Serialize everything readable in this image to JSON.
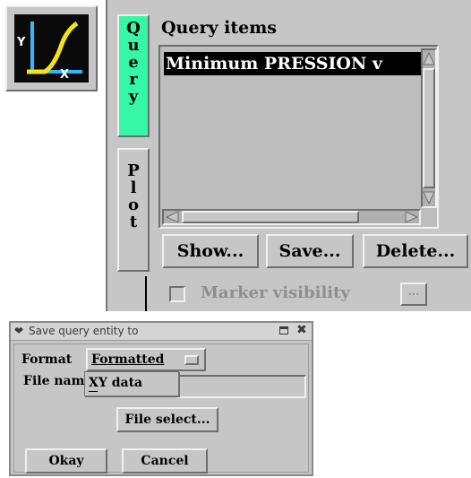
{
  "toolbar_icon": {
    "name": "xy-plot-icon",
    "y_label": "Y",
    "x_label": "X"
  },
  "tabs": {
    "query": {
      "letters": [
        "Q",
        "u",
        "e",
        "r",
        "y"
      ]
    },
    "plot": {
      "letters": [
        "P",
        "l",
        "o",
        "t"
      ]
    }
  },
  "query_panel": {
    "title": "Query items",
    "items": [
      "Minimum PRESSION v"
    ],
    "show_label": "Show...",
    "save_label": "Save...",
    "delete_label": "Delete...",
    "marker_label": "Marker visibility",
    "marker_more_label": "..."
  },
  "dialog": {
    "title": "Save query entity to",
    "format_label": "Format",
    "format_value": "Formatted",
    "filename_label": "File name",
    "dropdown_options": [
      "XY data"
    ],
    "file_select_label": "File select...",
    "okay_label": "Okay",
    "cancel_label": "Cancel"
  },
  "colors": {
    "panel": "#c6c6c6",
    "active_tab": "#35f7a5",
    "list_bg": "#bdbdbd",
    "selection": "#000000",
    "icon_bg": "#0a0a0a",
    "icon_curve": "#f6e312",
    "icon_axes": "#2fb8ff"
  }
}
